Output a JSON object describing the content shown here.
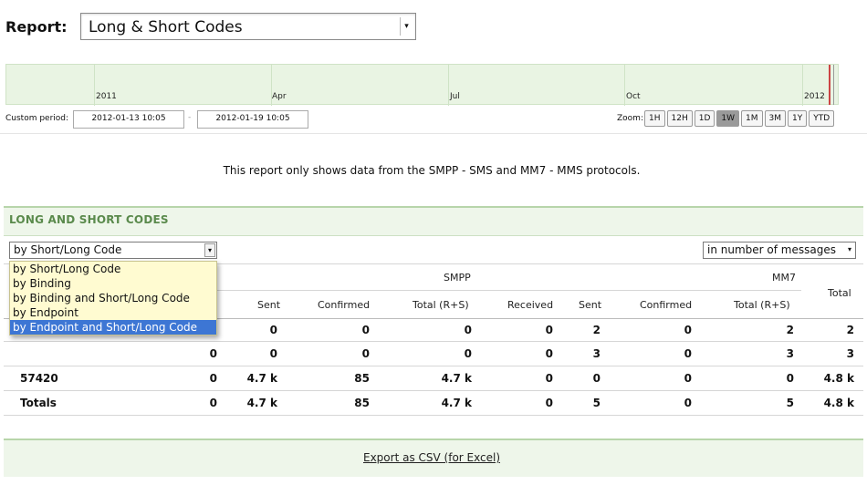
{
  "report": {
    "label": "Report:",
    "selected": "Long & Short Codes"
  },
  "timeline": {
    "labels": [
      "2011",
      "Apr",
      "Jul",
      "Oct",
      "2012"
    ]
  },
  "period": {
    "custom_label": "Custom period:",
    "from": "2012-01-13 10:05",
    "dash": "-",
    "to": "2012-01-19 10:05"
  },
  "zoom": {
    "label": "Zoom:",
    "buttons": [
      "1H",
      "12H",
      "1D",
      "1W",
      "1M",
      "3M",
      "1Y",
      "YTD"
    ],
    "active": "1W"
  },
  "notice": "This report only shows data from the SMPP - SMS and MM7 - MMS protocols.",
  "panel": {
    "title": "LONG AND SHORT CODES",
    "group_select": "by Short/Long Code",
    "group_options": [
      "by Short/Long Code",
      "by Binding",
      "by Binding and Short/Long Code",
      "by Endpoint",
      "by Endpoint and Short/Long Code"
    ],
    "highlighted_option": "by Endpoint and Short/Long Code",
    "unit_select": "in number of messages"
  },
  "table": {
    "groups": {
      "smpp": "SMPP",
      "mm7": "MM7"
    },
    "headers": [
      "Sent",
      "Confirmed",
      "Total (R+S)",
      "Received",
      "Sent",
      "Confirmed",
      "Total (R+S)",
      "Total"
    ],
    "rows": [
      {
        "code": "",
        "c0": "",
        "c1": "0",
        "c2": "0",
        "c3": "0",
        "c4": "0",
        "c5": "2",
        "c6": "0",
        "c7": "2",
        "c8": "2"
      },
      {
        "code": "",
        "c0": "0",
        "c1": "0",
        "c2": "0",
        "c3": "0",
        "c4": "0",
        "c5": "3",
        "c6": "0",
        "c7": "3",
        "c8": "3"
      },
      {
        "code": "57420",
        "c0": "0",
        "c1": "4.7 k",
        "c2": "85",
        "c3": "4.7 k",
        "c4": "0",
        "c5": "0",
        "c6": "0",
        "c7": "0",
        "c8": "4.8 k"
      },
      {
        "code": "Totals",
        "c0": "0",
        "c1": "4.7 k",
        "c2": "85",
        "c3": "4.7 k",
        "c4": "0",
        "c5": "5",
        "c6": "0",
        "c7": "5",
        "c8": "4.8 k"
      }
    ]
  },
  "footer": {
    "export_label": "Export as CSV (for Excel)"
  },
  "colors": {
    "panel_green": "#eef6ea",
    "title_green": "#5a8a4c",
    "highlight_blue": "#3d76d4",
    "dropdown_yellow": "#fffbd1"
  }
}
